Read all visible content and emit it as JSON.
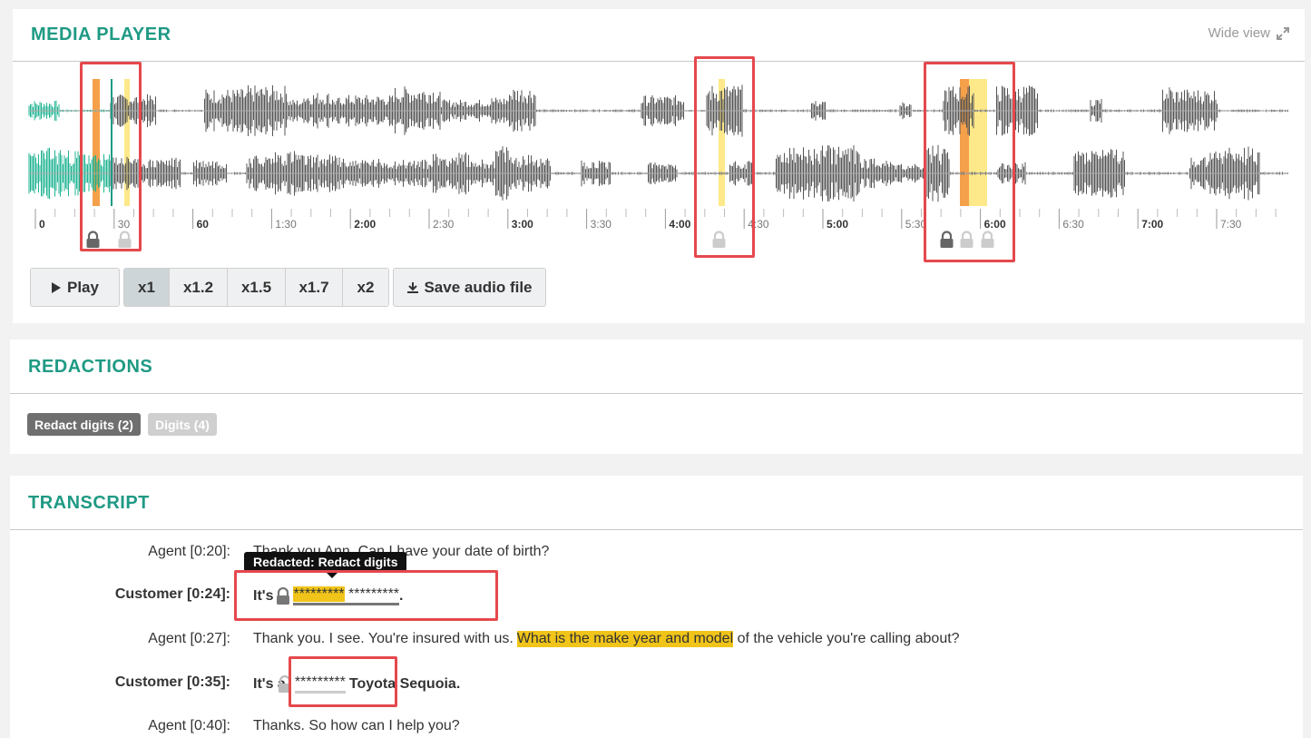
{
  "media_player": {
    "title": "MEDIA  PLAYER",
    "wide_view_label": "Wide  view",
    "timeline_ticks": [
      {
        "label": "0",
        "bold": true
      },
      {
        "label": "30",
        "bold": false
      },
      {
        "label": "60",
        "bold": true
      },
      {
        "label": "1:30",
        "bold": false
      },
      {
        "label": "2:00",
        "bold": true
      },
      {
        "label": "2:30",
        "bold": false
      },
      {
        "label": "3:00",
        "bold": true
      },
      {
        "label": "3:30",
        "bold": false
      },
      {
        "label": "4:00",
        "bold": true
      },
      {
        "label": "4:30",
        "bold": false
      },
      {
        "label": "5:00",
        "bold": true
      },
      {
        "label": "5:30",
        "bold": false
      },
      {
        "label": "6:00",
        "bold": true
      },
      {
        "label": "6:30",
        "bold": false
      },
      {
        "label": "7:00",
        "bold": true
      },
      {
        "label": "7:30",
        "bold": false
      }
    ],
    "controls": {
      "play_label": "Play",
      "speeds": [
        "x1",
        "x1.2",
        "x1.5",
        "x1.7",
        "x2"
      ],
      "active_speed": "x1",
      "save_label": "Save audio file"
    },
    "colors": {
      "played": "#1fb392",
      "unplayed": "#555555",
      "redact_digits": "#f5a04a",
      "digits": "#fde98a",
      "accent": "#1f9a84"
    }
  },
  "redactions": {
    "title": "REDACTIONS",
    "tags": [
      {
        "label": "Redact digits (2)",
        "color": "#6f6f6f"
      },
      {
        "label": "Digits (4)",
        "color": "#cfcfcf"
      }
    ]
  },
  "transcript": {
    "title": "TRANSCRIPT",
    "tooltip": "Redacted: Redact digits",
    "rows": [
      {
        "speaker": "Agent [0:20]:",
        "text": "Thank you Ann. Can I have your date of birth?"
      },
      {
        "speaker": "Customer [0:24]:",
        "prefix": "It's",
        "masked_a": "*********",
        "masked_b": "*********",
        "suffix": "."
      },
      {
        "speaker": "Agent [0:27]:",
        "pre": "Thank you. I see. You're insured with us.",
        "highlight": "What is the make year and model",
        "post": " of the vehicle you're calling about?"
      },
      {
        "speaker": "Customer [0:35]:",
        "prefix": "It's a",
        "masked": "*********",
        "suffix": "Toyota Sequoia."
      },
      {
        "speaker": "Agent [0:40]:",
        "text": "Thanks. So how can I help you?"
      }
    ]
  }
}
